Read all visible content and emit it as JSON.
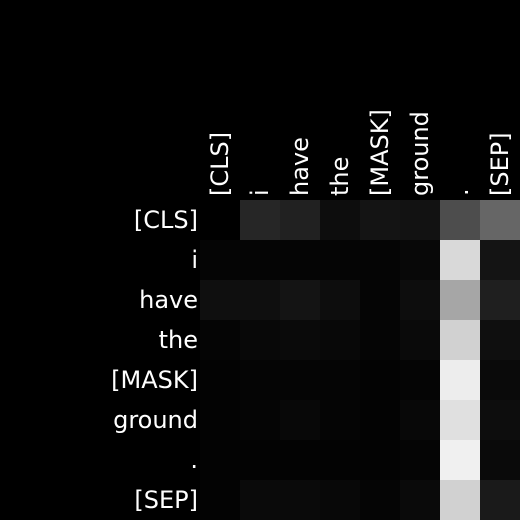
{
  "chart_data": {
    "type": "heatmap",
    "title": "",
    "xlabel": "",
    "ylabel": "",
    "x_labels": [
      "[CLS]",
      "i",
      "have",
      "the",
      "[MASK]",
      "ground",
      ".",
      "[SEP]"
    ],
    "y_labels": [
      "[CLS]",
      "i",
      "have",
      "the",
      "[MASK]",
      "ground",
      ".",
      "[SEP]"
    ],
    "x_label_position": "top",
    "colormap": "grayscale",
    "value_range": [
      0,
      1
    ],
    "values": [
      [
        0.0,
        0.15,
        0.13,
        0.05,
        0.08,
        0.07,
        0.3,
        0.4
      ],
      [
        0.02,
        0.02,
        0.02,
        0.02,
        0.02,
        0.03,
        0.85,
        0.08
      ],
      [
        0.06,
        0.06,
        0.08,
        0.05,
        0.02,
        0.05,
        0.65,
        0.12
      ],
      [
        0.02,
        0.03,
        0.04,
        0.03,
        0.02,
        0.04,
        0.82,
        0.06
      ],
      [
        0.01,
        0.02,
        0.02,
        0.02,
        0.01,
        0.02,
        0.93,
        0.04
      ],
      [
        0.01,
        0.02,
        0.03,
        0.02,
        0.01,
        0.03,
        0.88,
        0.05
      ],
      [
        0.01,
        0.01,
        0.01,
        0.01,
        0.01,
        0.02,
        0.94,
        0.04
      ],
      [
        0.01,
        0.04,
        0.04,
        0.03,
        0.02,
        0.04,
        0.82,
        0.1
      ]
    ],
    "grid": false,
    "legend": "none"
  }
}
